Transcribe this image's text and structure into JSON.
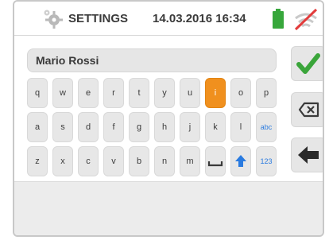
{
  "header": {
    "title": "SETTINGS",
    "datetime": "14.03.2016 16:34",
    "icons": [
      "gear-icon",
      "battery-icon",
      "wifi-off-icon"
    ]
  },
  "input": {
    "value": "Mario Rossi"
  },
  "keyboard": {
    "row1": [
      "q",
      "w",
      "e",
      "r",
      "t",
      "y",
      "u",
      "i",
      "o",
      "p"
    ],
    "row2": [
      "a",
      "s",
      "d",
      "f",
      "g",
      "h",
      "j",
      "k",
      "l",
      "abc"
    ],
    "row3": [
      "z",
      "x",
      "c",
      "v",
      "b",
      "n",
      "m",
      "space-icon",
      "shift-icon",
      "123"
    ],
    "active_key": "i"
  },
  "side_buttons": [
    "confirm-check-icon",
    "backspace-icon",
    "back-arrow-icon"
  ],
  "colors": {
    "active_key": "#f0901e",
    "check": "#3aa53a",
    "battery": "#37a73b",
    "wifi_slash": "#e23b3b",
    "blue_label": "#2a7be0"
  }
}
